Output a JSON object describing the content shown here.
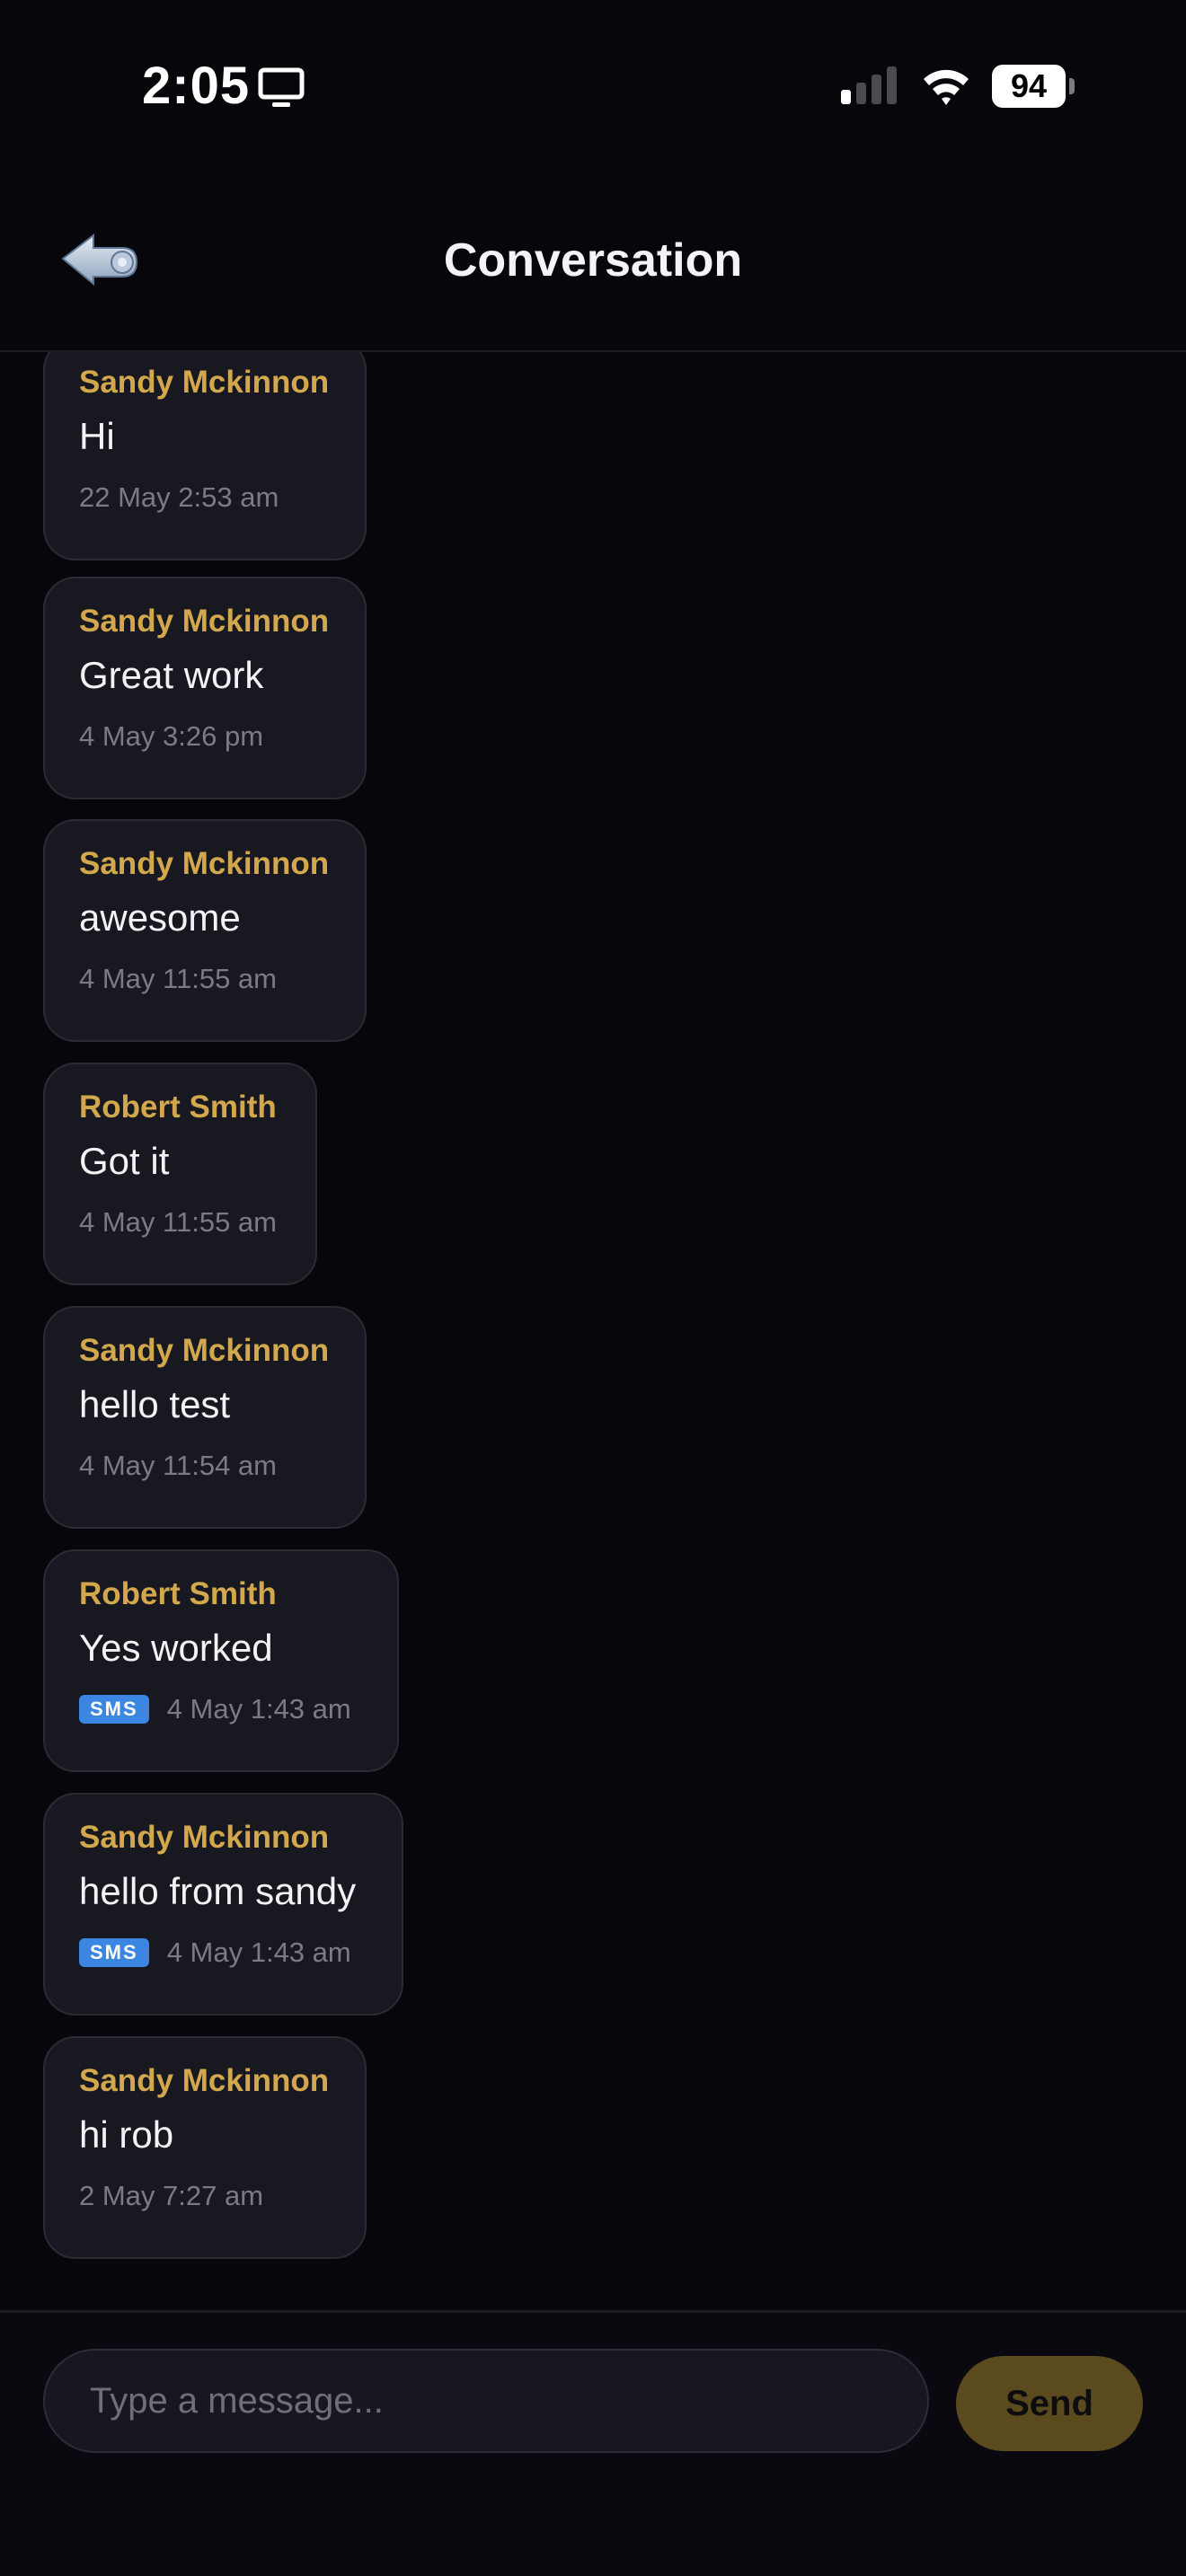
{
  "status_bar": {
    "time": "2:05",
    "battery": "94",
    "icons": [
      "screen-mirroring-icon",
      "cellular-signal-icon",
      "wifi-icon",
      "battery-icon"
    ]
  },
  "header": {
    "title": "Conversation",
    "back_icon": "back-arrow-icon"
  },
  "messages": [
    {
      "sender": "Sandy Mckinnon",
      "text": "Hi",
      "timestamp": "22 May 2:53 am",
      "sms": false
    },
    {
      "sender": "Sandy Mckinnon",
      "text": "Great work",
      "timestamp": "4 May 3:26 pm",
      "sms": false
    },
    {
      "sender": "Sandy Mckinnon",
      "text": "awesome",
      "timestamp": "4 May 11:55 am",
      "sms": false
    },
    {
      "sender": "Robert Smith",
      "text": "Got it",
      "timestamp": "4 May 11:55 am",
      "sms": false
    },
    {
      "sender": "Sandy Mckinnon",
      "text": "hello test",
      "timestamp": "4 May 11:54 am",
      "sms": false
    },
    {
      "sender": "Robert Smith",
      "text": "Yes worked",
      "timestamp": "4 May 1:43 am",
      "sms": true,
      "badge": "SMS"
    },
    {
      "sender": "Sandy Mckinnon",
      "text": "hello from sandy",
      "timestamp": "4 May 1:43 am",
      "sms": true,
      "badge": "SMS"
    },
    {
      "sender": "Sandy Mckinnon",
      "text": "hi rob",
      "timestamp": "2 May 7:27 am",
      "sms": false
    }
  ],
  "composer": {
    "placeholder": "Type a message...",
    "value": "",
    "send_label": "Send"
  },
  "colors": {
    "background": "#07070b",
    "bubble": "#171820",
    "sender": "#d3a84d",
    "sms_badge": "#3a86e0",
    "send_button": "#5a4a1e"
  }
}
